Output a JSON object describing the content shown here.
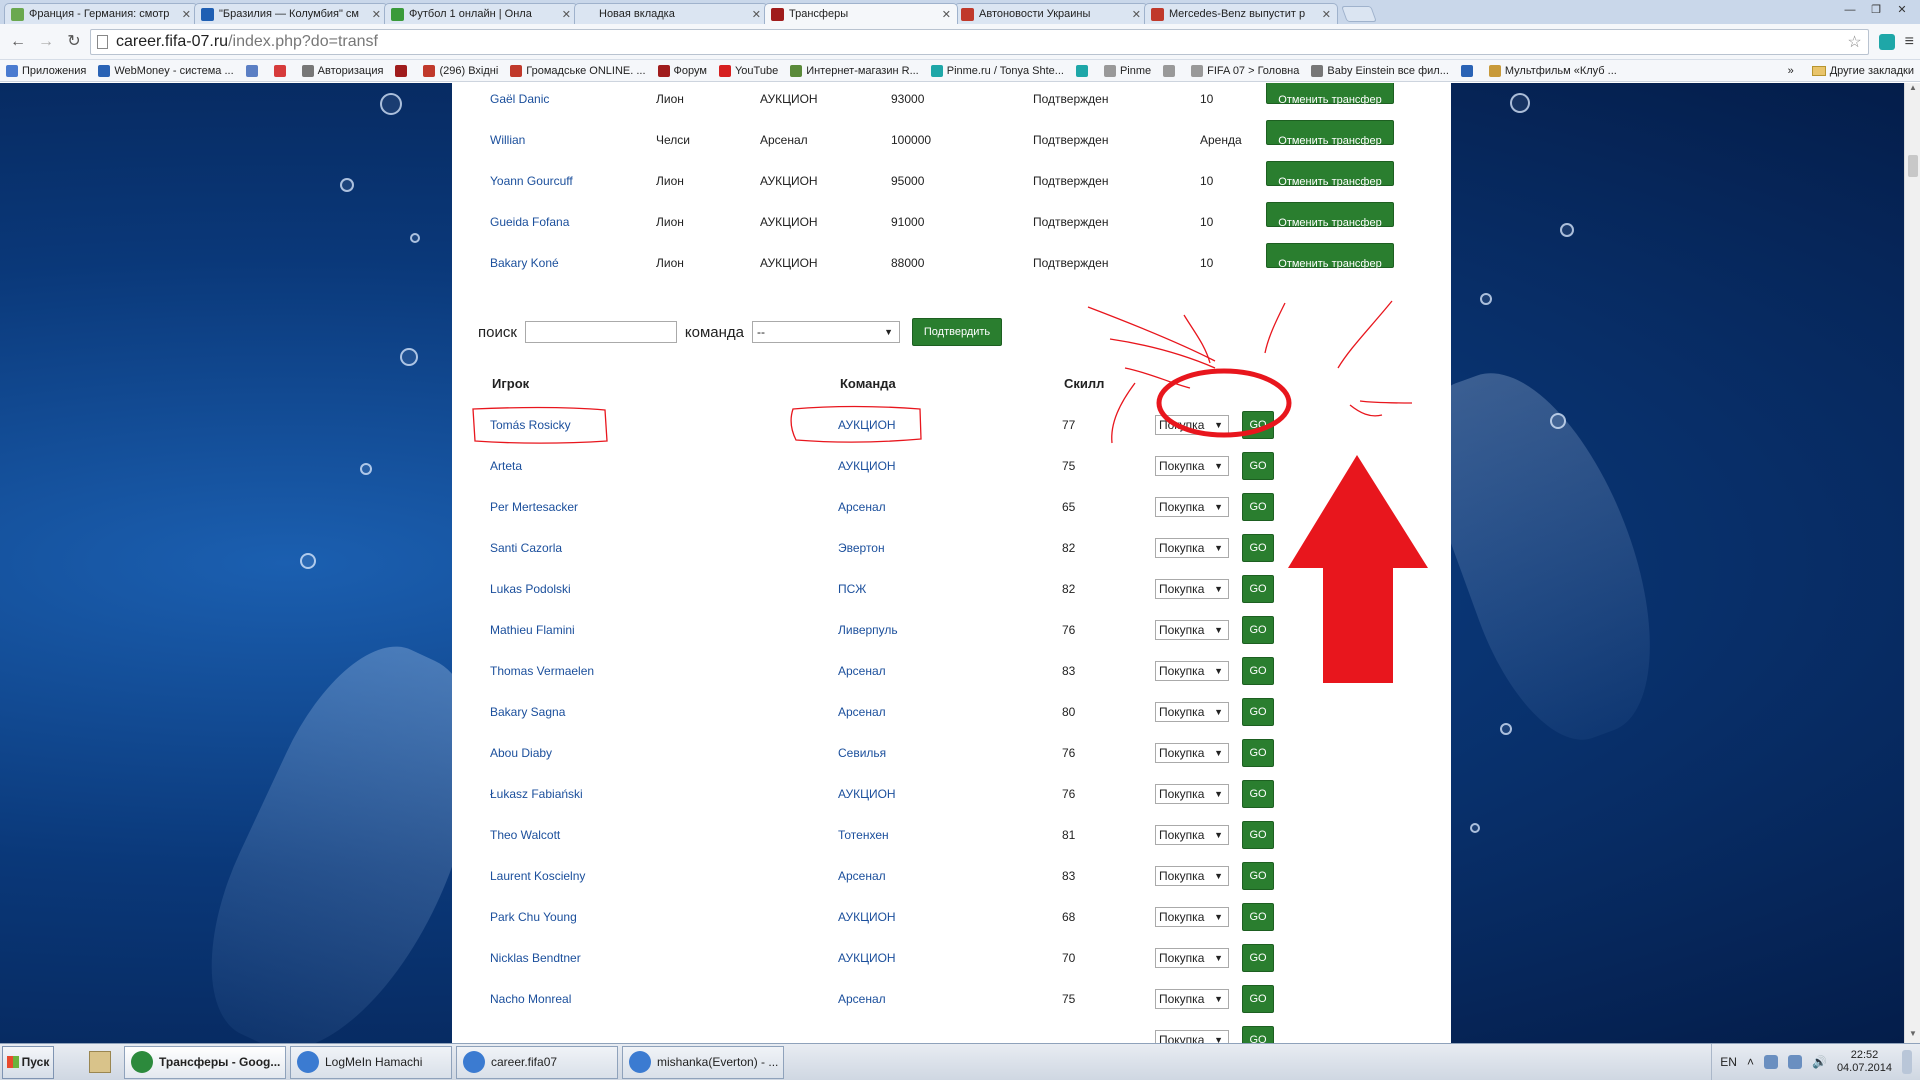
{
  "browser": {
    "tabs": [
      {
        "title": "Франция - Германия: смотр",
        "color": "#6aa84f",
        "active": false
      },
      {
        "title": "\"Бразилия — Колумбия\" см",
        "color": "#1f5fb3",
        "active": false
      },
      {
        "title": "Футбол 1 онлайн | Онла",
        "color": "#3a9a3a",
        "active": false
      },
      {
        "title": "Новая вкладка",
        "color": "#dbe5f2",
        "active": false
      },
      {
        "title": "Трансферы",
        "color": "#a01c1c",
        "active": true
      },
      {
        "title": "Автоновости Украины",
        "color": "#c0392b",
        "active": false
      },
      {
        "title": "Mercedes-Benz выпустит р",
        "color": "#c0392b",
        "active": false
      }
    ],
    "url_host": "career.fifa-07.ru",
    "url_path": "/index.php?do=transf",
    "bookmarks": [
      {
        "label": "Приложения",
        "color": "#4a7bd0"
      },
      {
        "label": "WebMoney - система ...",
        "color": "#2a63b5"
      },
      {
        "label": "",
        "color": "#5b7fc4"
      },
      {
        "label": "",
        "color": "#d63b3b"
      },
      {
        "label": "Авторизация",
        "color": "#777777"
      },
      {
        "label": "",
        "color": "#a01c1c"
      },
      {
        "label": "(296) Вхідні",
        "color": "#c0392b"
      },
      {
        "label": "Громадське ONLINE. ...",
        "color": "#c0392b"
      },
      {
        "label": "Форум",
        "color": "#a01c1c"
      },
      {
        "label": "YouTube",
        "color": "#d62020"
      },
      {
        "label": "Интернет-магазин R...",
        "color": "#5a8a3a"
      },
      {
        "label": "Pinme.ru / Tonya Shte...",
        "color": "#1ea7a8"
      },
      {
        "label": "",
        "color": "#1ea7a8"
      },
      {
        "label": "Pinme",
        "color": "#999999"
      },
      {
        "label": "",
        "color": "#999999"
      },
      {
        "label": "FIFA 07 > Головна",
        "color": "#999999"
      },
      {
        "label": "Baby Einstein все фил...",
        "color": "#777777"
      },
      {
        "label": "",
        "color": "#2a63b5"
      },
      {
        "label": "Мультфильм «Клуб ...",
        "color": "#c89a3a"
      }
    ],
    "more_bookmarks": "»",
    "other_bookmarks": "Другие закладки"
  },
  "transfers": [
    {
      "player": "Gaël Danic",
      "from": "Лион",
      "to": "АУКЦИОН",
      "price": "93000",
      "status": "Подтвержден",
      "term": "10",
      "action": "Отменить трансфер"
    },
    {
      "player": "Willian",
      "from": "Челси",
      "to": "Арсенал",
      "price": "100000",
      "status": "Подтвержден",
      "term": "Аренда",
      "action": "Отменить трансфер"
    },
    {
      "player": "Yoann Gourcuff",
      "from": "Лион",
      "to": "АУКЦИОН",
      "price": "95000",
      "status": "Подтвержден",
      "term": "10",
      "action": "Отменить трансфер"
    },
    {
      "player": "Gueida Fofana",
      "from": "Лион",
      "to": "АУКЦИОН",
      "price": "91000",
      "status": "Подтвержден",
      "term": "10",
      "action": "Отменить трансфер"
    },
    {
      "player": "Bakary Koné",
      "from": "Лион",
      "to": "АУКЦИОН",
      "price": "88000",
      "status": "Подтвержден",
      "term": "10",
      "action": "Отменить трансфер"
    }
  ],
  "filter": {
    "search_label": "поиск",
    "search_value": "",
    "team_label": "команда",
    "team_value": "--",
    "confirm_label": "Подтвердить"
  },
  "players_table": {
    "headers": {
      "player": "Игрок",
      "team": "Команда",
      "skill": "Скилл"
    },
    "action_option": "Покупка",
    "go_label": "GO",
    "rows": [
      {
        "name": "Tomás Rosicky",
        "team": "АУКЦИОН",
        "skill": "77"
      },
      {
        "name": "Arteta",
        "team": "АУКЦИОН",
        "skill": "75"
      },
      {
        "name": "Per Mertesacker",
        "team": "Арсенал",
        "skill": "65"
      },
      {
        "name": "Santi Cazorla",
        "team": "Эвертон",
        "skill": "82"
      },
      {
        "name": "Lukas Podolski",
        "team": "ПСЖ",
        "skill": "82"
      },
      {
        "name": "Mathieu Flamini",
        "team": "Ливерпуль",
        "skill": "76"
      },
      {
        "name": "Thomas Vermaelen",
        "team": "Арсенал",
        "skill": "83"
      },
      {
        "name": "Bakary Sagna",
        "team": "Арсенал",
        "skill": "80"
      },
      {
        "name": "Abou Diaby",
        "team": "Севилья",
        "skill": "76"
      },
      {
        "name": "Łukasz Fabiański",
        "team": "АУКЦИОН",
        "skill": "76"
      },
      {
        "name": "Theo Walcott",
        "team": "Тотенхен",
        "skill": "81"
      },
      {
        "name": "Laurent Koscielny",
        "team": "Арсенал",
        "skill": "83"
      },
      {
        "name": "Park Chu Young",
        "team": "АУКЦИОН",
        "skill": "68"
      },
      {
        "name": "Nicklas Bendtner",
        "team": "АУКЦИОН",
        "skill": "70"
      },
      {
        "name": "Nacho Monreal",
        "team": "Арсенал",
        "skill": "75"
      },
      {
        "name": "",
        "team": "",
        "skill": ""
      }
    ]
  },
  "annotation_color": "#e8161d",
  "taskbar": {
    "start_label": "Пуск",
    "tasks": [
      {
        "label": "Трансферы - Goog...",
        "color": "#2c8a3c",
        "active": true
      },
      {
        "label": "LogMeIn Hamachi",
        "color": "#3b7bd1",
        "active": false
      },
      {
        "label": "career.fifa07",
        "color": "#3b7bd1",
        "active": false
      },
      {
        "label": "mishanka(Everton) - ...",
        "color": "#3b7bd1",
        "active": false
      }
    ],
    "lang": "EN",
    "time": "22:52",
    "date": "04.07.2014"
  }
}
